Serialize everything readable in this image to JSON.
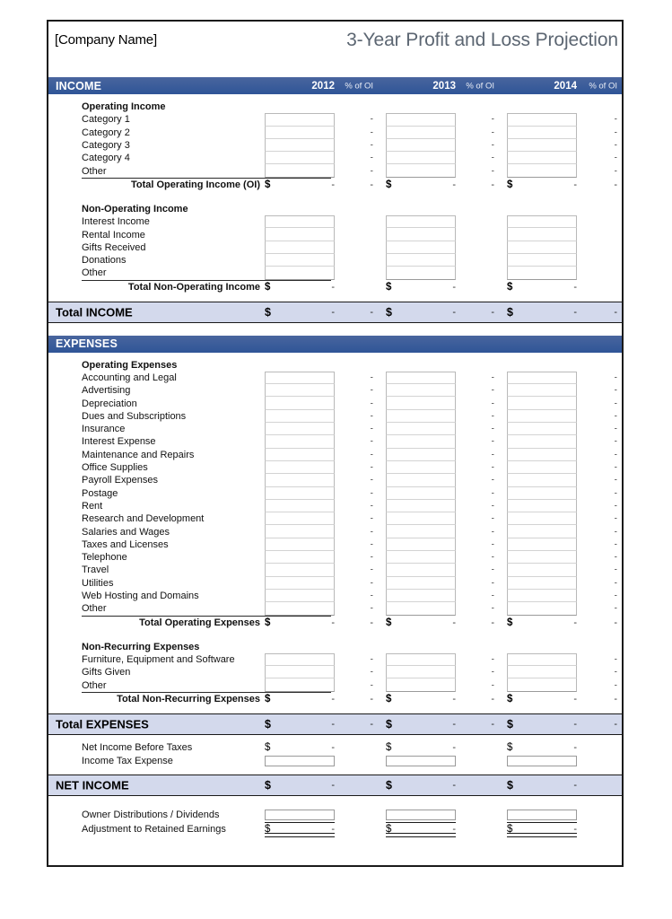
{
  "header": {
    "company": "[Company Name]",
    "title": "3-Year Profit and Loss Projection"
  },
  "columns": {
    "income_band_label": "INCOME",
    "expenses_band_label": "EXPENSES",
    "year1": "2012",
    "year2": "2013",
    "year3": "2014",
    "pct1": "% of OI",
    "pct2": "% of OI",
    "pct3": "% of OI"
  },
  "symbols": {
    "dollar": "$",
    "dash": "-"
  },
  "sections": {
    "operating_income": {
      "heading": "Operating Income",
      "rows": [
        "Category 1",
        "Category 2",
        "Category 3",
        "Category 4",
        "Other"
      ],
      "total_label": "Total Operating Income (OI)"
    },
    "non_operating_income": {
      "heading": "Non-Operating Income",
      "rows": [
        "Interest Income",
        "Rental Income",
        "Gifts Received",
        "Donations",
        "Other"
      ],
      "total_label": "Total Non-Operating Income"
    },
    "total_income": {
      "label": "Total INCOME"
    },
    "operating_expenses": {
      "heading": "Operating Expenses",
      "rows": [
        "Accounting and Legal",
        "Advertising",
        "Depreciation",
        "Dues and Subscriptions",
        "Insurance",
        "Interest Expense",
        "Maintenance and Repairs",
        "Office Supplies",
        "Payroll Expenses",
        "Postage",
        "Rent",
        "Research and Development",
        "Salaries and Wages",
        "Taxes and Licenses",
        "Telephone",
        "Travel",
        "Utilities",
        "Web Hosting and Domains",
        "Other"
      ],
      "total_label": "Total Operating Expenses"
    },
    "non_recurring_expenses": {
      "heading": "Non-Recurring Expenses",
      "rows": [
        "Furniture, Equipment and Software",
        "Gifts Given",
        "Other"
      ],
      "total_label": "Total Non-Recurring Expenses"
    },
    "total_expenses": {
      "label": "Total EXPENSES"
    },
    "pretax": {
      "net_before_taxes_label": "Net Income Before Taxes",
      "income_tax_label": "Income Tax Expense"
    },
    "net_income": {
      "label": "NET INCOME"
    },
    "footer": {
      "distributions_label": "Owner Distributions / Dividends",
      "retained_label": "Adjustment to Retained Earnings"
    }
  },
  "colors": {
    "band_blue": "#3a5d9c",
    "summary_blue": "#d3d9ec",
    "title_gray": "#5c6672"
  }
}
